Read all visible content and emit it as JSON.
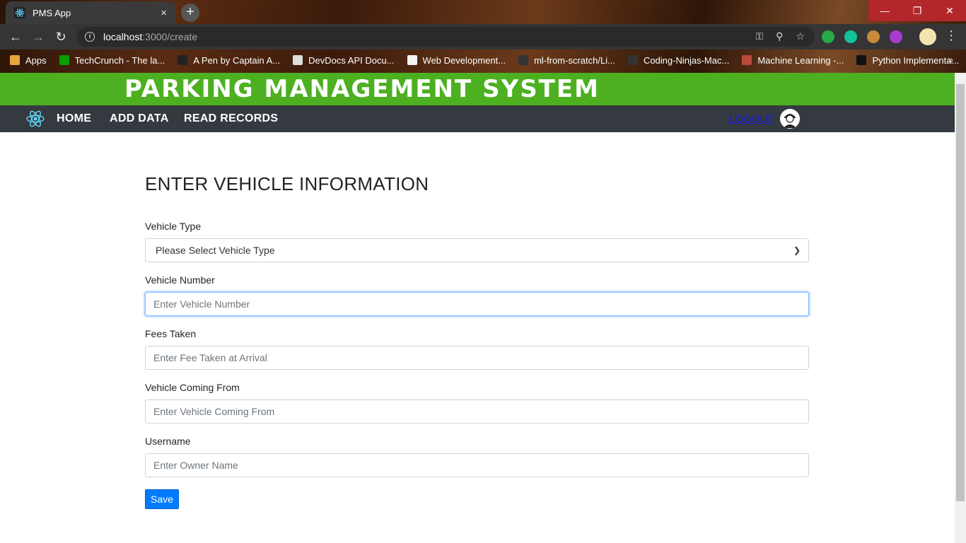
{
  "browser": {
    "tab_title": "PMS App",
    "tab_close": "×",
    "new_tab": "+",
    "url_host": "localhost",
    "url_path": ":3000/create",
    "bookmarks": [
      {
        "label": "Apps",
        "color": "#e8a33d"
      },
      {
        "label": "TechCrunch - The la...",
        "color": "#0a9e01"
      },
      {
        "label": "A Pen by Captain A...",
        "color": "#222222"
      },
      {
        "label": "DevDocs API Docu...",
        "color": "#dddddd"
      },
      {
        "label": "Web Development...",
        "color": "#f3f3f3"
      },
      {
        "label": "ml-from-scratch/Li...",
        "color": "#333333"
      },
      {
        "label": "Coding-Ninjas-Mac...",
        "color": "#333333"
      },
      {
        "label": "Machine Learning -...",
        "color": "#b94a3a"
      },
      {
        "label": "Python Implementa...",
        "color": "#111111"
      }
    ],
    "bookmarks_more": "»"
  },
  "app": {
    "title": "PARKING MANAGEMENT SYSTEM",
    "header_color": "#4cb021",
    "nav": {
      "home": "HOME",
      "add_data": "ADD DATA",
      "read_records": "READ RECORDS",
      "logout": "LOGOUT"
    }
  },
  "form": {
    "title": "ENTER VEHICLE INFORMATION",
    "vehicle_type": {
      "label": "Vehicle Type",
      "selected": "Please Select Vehicle Type"
    },
    "vehicle_number": {
      "label": "Vehicle Number",
      "placeholder": "Enter Vehicle Number"
    },
    "fees_taken": {
      "label": "Fees Taken",
      "placeholder": "Enter Fee Taken at Arrival"
    },
    "coming_from": {
      "label": "Vehicle Coming From",
      "placeholder": "Enter Vehicle Coming From"
    },
    "username": {
      "label": "Username",
      "placeholder": "Enter Owner Name"
    },
    "save_label": "Save"
  }
}
